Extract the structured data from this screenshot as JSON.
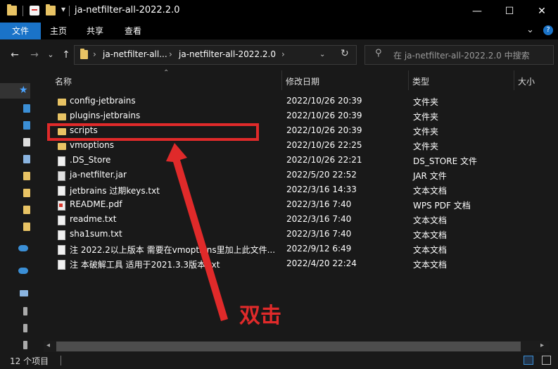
{
  "window": {
    "title": "ja-netfilter-all-2022.2.0",
    "controls": {
      "minimize": "—",
      "maximize": "☐",
      "close": "✕"
    }
  },
  "ribbon": {
    "tabs": [
      "文件",
      "主页",
      "共享",
      "查看"
    ],
    "expand": "⌄",
    "help": "?"
  },
  "nav": {
    "back": "←",
    "forward": "→",
    "recent": "⌄",
    "up": "↑",
    "breadcrumb": [
      "ja-netfilter-all...",
      "ja-netfilter-all-2022.2.0"
    ],
    "refresh": "↻",
    "search_placeholder": "在 ja-netfilter-all-2022.2.0 中搜索"
  },
  "columns": {
    "name": "名称",
    "modified": "修改日期",
    "type": "类型",
    "size": "大小"
  },
  "files": [
    {
      "name": "config-jetbrains",
      "modified": "2022/10/26 20:39",
      "type": "文件夹",
      "icon": "folder"
    },
    {
      "name": "plugins-jetbrains",
      "modified": "2022/10/26 20:39",
      "type": "文件夹",
      "icon": "folder"
    },
    {
      "name": "scripts",
      "modified": "2022/10/26 20:39",
      "type": "文件夹",
      "icon": "folder"
    },
    {
      "name": "vmoptions",
      "modified": "2022/10/26 22:25",
      "type": "文件夹",
      "icon": "folder"
    },
    {
      "name": ".DS_Store",
      "modified": "2022/10/26 22:21",
      "type": "DS_STORE 文件",
      "icon": "doc"
    },
    {
      "name": "ja-netfilter.jar",
      "modified": "2022/5/20 22:52",
      "type": "JAR 文件",
      "icon": "jar"
    },
    {
      "name": "jetbrains 过期keys.txt",
      "modified": "2022/3/16 14:33",
      "type": "文本文档",
      "icon": "doc"
    },
    {
      "name": "README.pdf",
      "modified": "2022/3/16 7:40",
      "type": "WPS PDF 文档",
      "icon": "pdf"
    },
    {
      "name": "readme.txt",
      "modified": "2022/3/16 7:40",
      "type": "文本文档",
      "icon": "doc"
    },
    {
      "name": "sha1sum.txt",
      "modified": "2022/3/16 7:40",
      "type": "文本文档",
      "icon": "doc"
    },
    {
      "name": "注 2022.2以上版本 需要在vmoptions里加上此文件...",
      "modified": "2022/9/12 6:49",
      "type": "文本文档",
      "icon": "doc"
    },
    {
      "name": "注 本破解工具 适用于2021.3.3版本.txt",
      "modified": "2022/4/20 22:24",
      "type": "文本文档",
      "icon": "doc"
    }
  ],
  "status": {
    "count": "12 个项目"
  },
  "annotation": {
    "label": "双击",
    "color": "#e02a2a"
  },
  "colors": {
    "accent": "#1a73c8",
    "folder": "#e8c364"
  }
}
